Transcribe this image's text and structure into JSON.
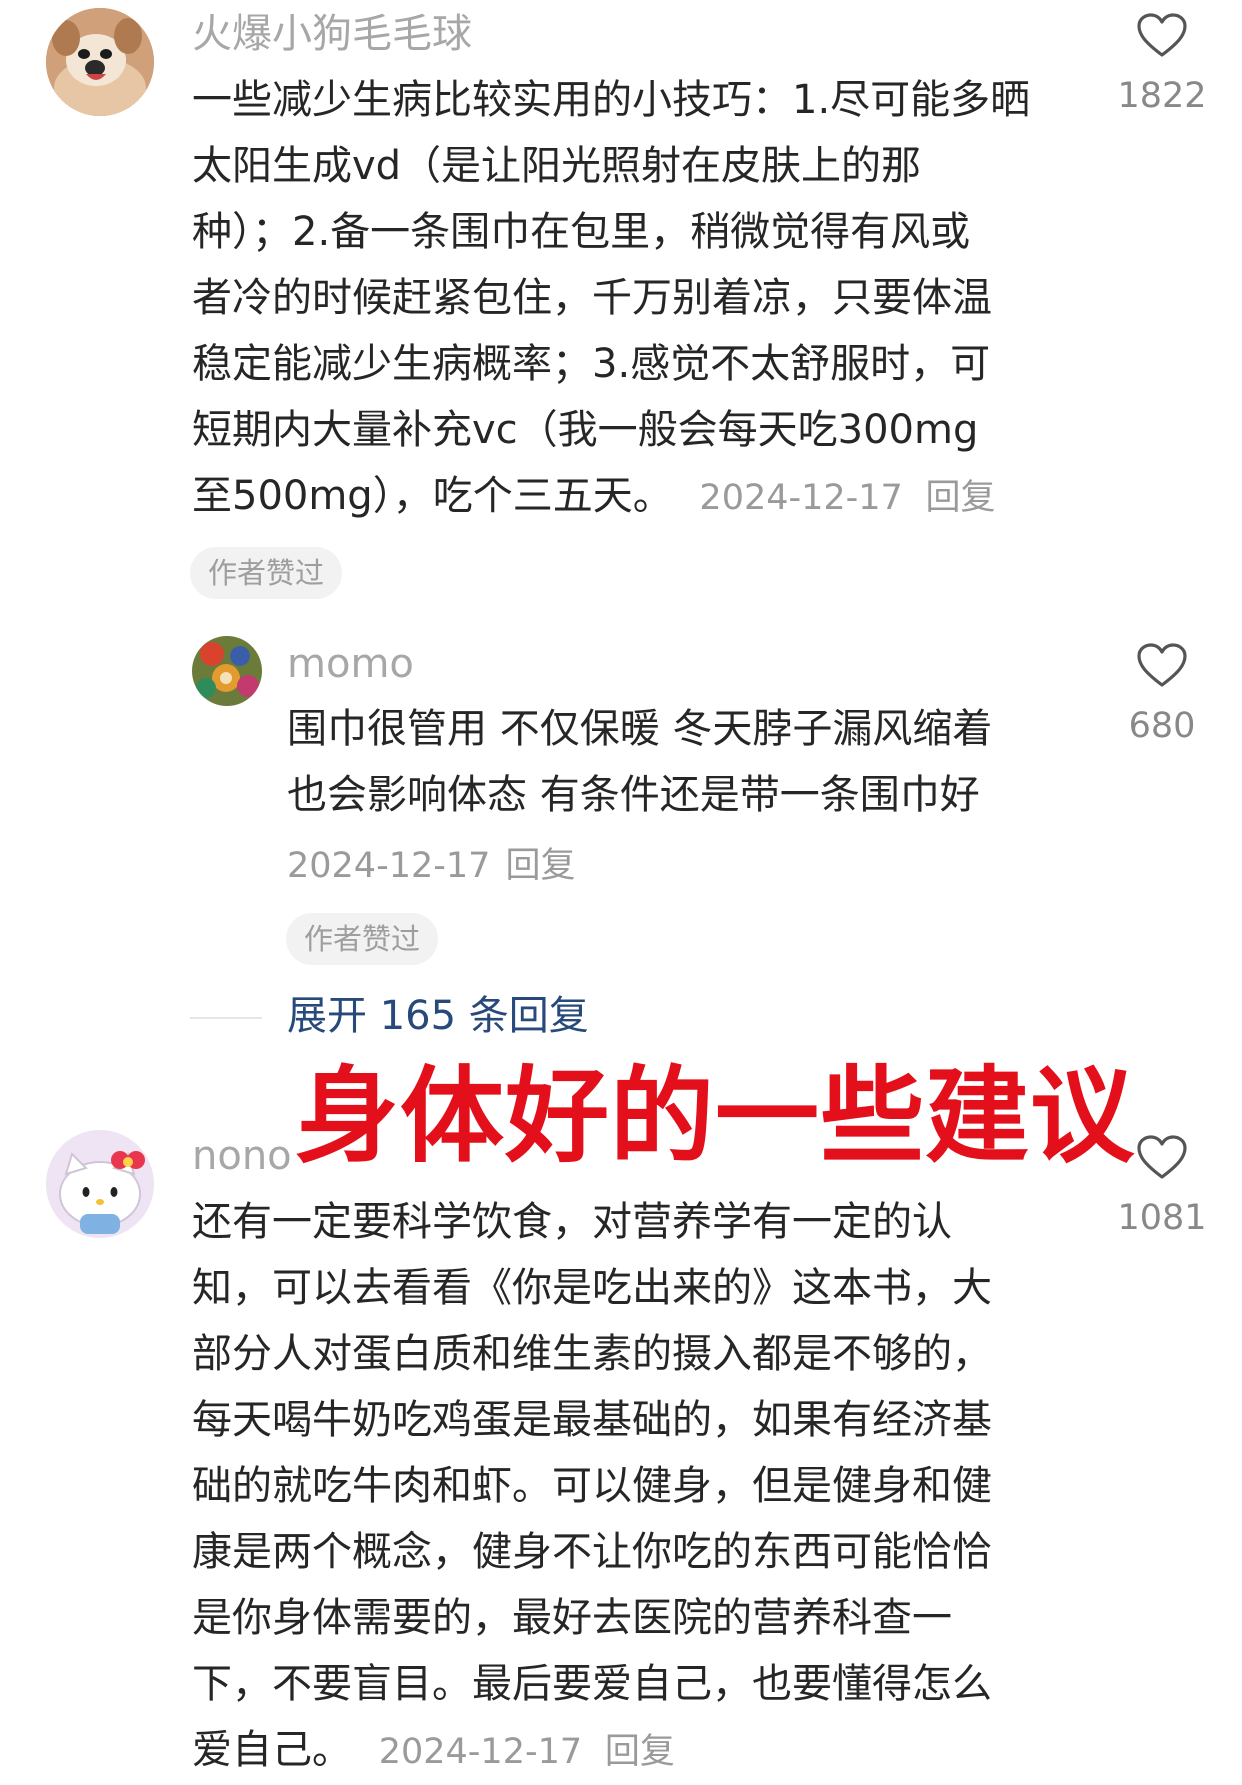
{
  "comments": [
    {
      "username": "火爆小狗毛毛球",
      "avatar_icon": "dog-avatar",
      "lines": [
        "一些减少生病比较实用的小技巧：1.尽可能多晒",
        "太阳生成vd（是让阳光照射在皮肤上的那",
        "种）；2.备一条围巾在包里，稍微觉得有风或",
        "者冷的时候赶紧包住，千万别着凉，只要体温",
        "稳定能减少生病概率；3.感觉不太舒服时，可",
        "短期内大量补充vc（我一般会每天吃300mg",
        "至500mg），吃个三五天。"
      ],
      "date": "2024-12-17",
      "reply_label": "回复",
      "like_count": "1822",
      "badge": "作者赞过"
    },
    {
      "username": "momo",
      "avatar_icon": "patterned-avatar",
      "lines": [
        "围巾很管用 不仅保暖 冬天脖子漏风缩着",
        "也会影响体态 有条件还是带一条围巾好"
      ],
      "date": "2024-12-17",
      "reply_label": "回复",
      "like_count": "680",
      "badge": "作者赞过"
    },
    {
      "username": "nono",
      "avatar_icon": "hello-kitty-avatar",
      "lines": [
        "还有一定要科学饮食，对营养学有一定的认",
        "知，可以去看看《你是吃出来的》这本书，大",
        "部分人对蛋白质和维生素的摄入都是不够的，",
        "每天喝牛奶吃鸡蛋是最基础的，如果有经济基",
        "础的就吃牛肉和虾。可以健身，但是健身和健",
        "康是两个概念，健身不让你吃的东西可能恰恰",
        "是你身体需要的，最好去医院的营养科查一",
        "下，不要盲目。最后要爱自己，也要懂得怎么",
        "爱自己。"
      ],
      "date": "2024-12-17",
      "reply_label": "回复",
      "like_count": "1081"
    }
  ],
  "expand_replies": "展开 165 条回复",
  "overlay_title": "身体好的一些建议",
  "colors": {
    "overlay_red": "#e3101b",
    "expand_link": "#274a7b",
    "muted_text": "#a7a7a7"
  }
}
